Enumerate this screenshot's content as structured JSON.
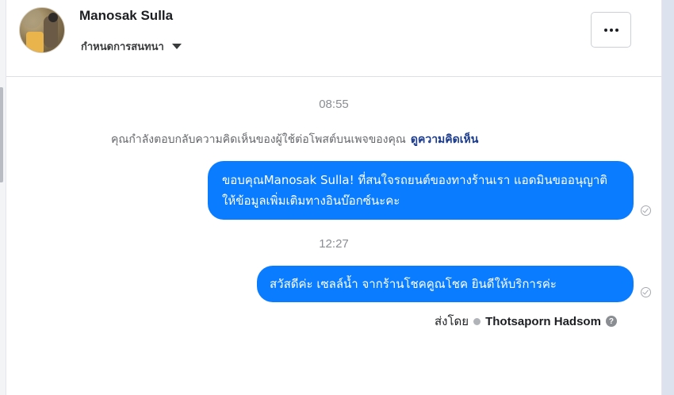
{
  "header": {
    "contact_name": "Manosak Sulla",
    "settings_label": "กำหนดการสนทนา",
    "more_label": "•••"
  },
  "thread": {
    "time_1": "08:55",
    "notice_text": "คุณกำลังตอบกลับความคิดเห็นของผู้ใช้ต่อโพสต์บนเพจของคุณ",
    "notice_link": "ดูความคิดเห็น",
    "message_1": "ขอบคุณManosak Sulla! ที่สนใจรถยนต์ของทางร้านเรา แอดมินขออนุญาติ ให้ข้อมูลเพิ่มเติมทางอินบ๊อกซ์นะคะ",
    "time_2": "12:27",
    "message_2": "สวัสดีค่ะ เซลล์น้ำ จากร้านโชคคูณโชค ยินดีให้บริการค่ะ",
    "sent_by_label": "ส่งโดย",
    "sender_name": "Thotsaporn Hadsom",
    "help_glyph": "?"
  },
  "colors": {
    "bubble": "#0a7cff",
    "link": "#1a3a8c"
  }
}
